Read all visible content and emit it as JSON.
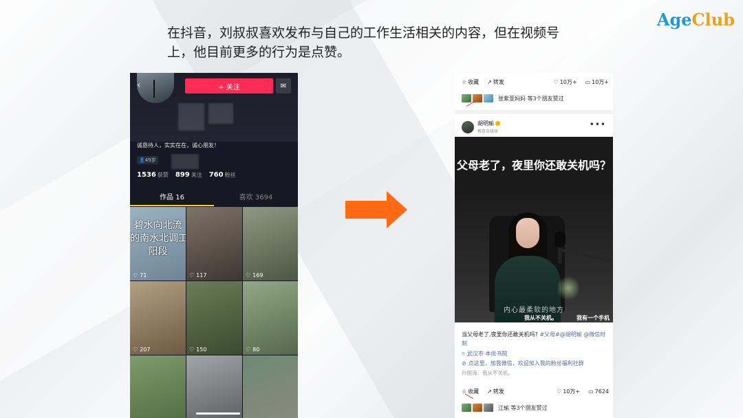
{
  "logo": {
    "part1": "Age",
    "part2": "Club"
  },
  "headline": "在抖音，刘叔叔喜欢发布与自己的工作生活相关的内容，但在视频号上，他目前更多的行为是点赞。",
  "douyin": {
    "follow_label": "+ 关注",
    "bio": "诚恳待人，实实在在，诚心朋友！",
    "age_tag": "49岁",
    "stats": {
      "likes_value": "1536",
      "likes_label": "获赞",
      "following_value": "899",
      "following_label": "关注",
      "fans_value": "760",
      "fans_label": "粉丝"
    },
    "tabs": {
      "works": "作品 16",
      "liked": "喜欢 3694"
    },
    "grid": [
      {
        "likes": "71",
        "caption_lines": [
          "碧水向北流",
          "的南水北调工",
          "阳段"
        ],
        "colors": [
          "#9ab3c3",
          "#6f8596"
        ]
      },
      {
        "likes": "117",
        "colors": [
          "#7e7468",
          "#3e3631"
        ]
      },
      {
        "likes": "169",
        "colors": [
          "#8d9a83",
          "#4c5743"
        ]
      },
      {
        "likes": "207",
        "colors": [
          "#b49f82",
          "#6d5a42"
        ]
      },
      {
        "likes": "150",
        "colors": [
          "#6a7d57",
          "#3b4a2d"
        ]
      },
      {
        "likes": "80",
        "colors": [
          "#93a886",
          "#55694a"
        ]
      },
      {
        "likes": "",
        "colors": [
          "#7f9c6d",
          "#4e6a3f"
        ]
      },
      {
        "likes": "",
        "colors": [
          "#a2a6a8",
          "#555a5e"
        ]
      },
      {
        "likes": "",
        "colors": [
          "#6e8a73",
          "#8c8a7c"
        ]
      }
    ]
  },
  "channels": {
    "top_card": {
      "collect": "收藏",
      "share": "转发",
      "likes": "10万+",
      "comments": "10万+",
      "friends_text": "张紫萱妈妈 等3个朋友赞过"
    },
    "main_card": {
      "author_name": "胡明瑜",
      "author_sub": "教育自媒体",
      "video_title": "父母老了，夜里你还敢关机吗？",
      "subtitle_main": "内心最柔软的地方",
      "subtitle_a": "我从不关机。",
      "subtitle_b": "我有一个手机",
      "description": "当父母老了,夜里你还敢关机吗? ",
      "tags": "#父母#@胡明瑜 @微信时刻",
      "location": "武汉市·本尚书院",
      "promo": "点这里，加我微信，欢迎加入我的粉丝福利社群",
      "comment": "孙国海：我从不关机。",
      "collect": "收藏",
      "share": "转发",
      "likes": "10万+",
      "comments": "7624",
      "friends_text": "江瑜 等3个朋友赞过"
    }
  },
  "colors": {
    "douyin_red": "#fe2c55",
    "arrow_orange": "#ff6a13",
    "link_blue": "#576b95"
  }
}
